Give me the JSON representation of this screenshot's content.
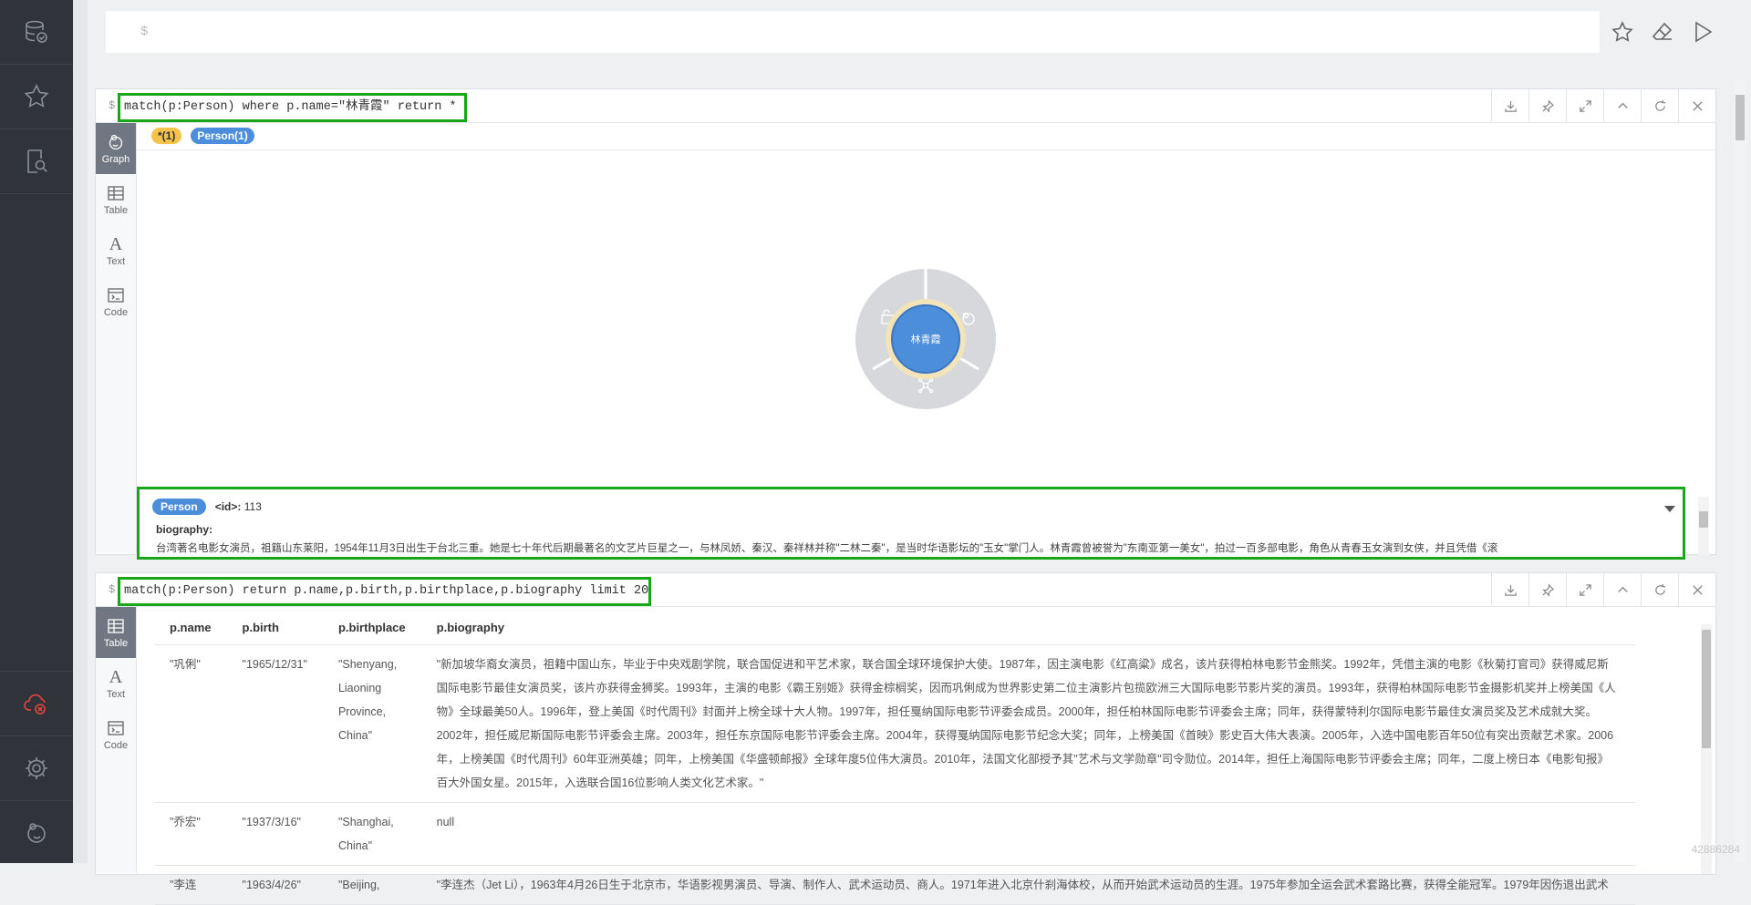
{
  "sidebar": {
    "top_icons": [
      "database-icon",
      "star-icon",
      "search-document-icon"
    ],
    "bottom_icons": [
      "cloud-error-icon",
      "gear-icon",
      "neo4j-logo-icon"
    ]
  },
  "editor": {
    "prompt": "$",
    "actions": [
      "favorite-star-icon",
      "eraser-icon",
      "play-icon"
    ]
  },
  "frame1": {
    "prompt": "$",
    "query": "match(p:Person) where p.name=\"林青霞\" return *",
    "tabs": [
      {
        "label": "Graph",
        "active": true
      },
      {
        "label": "Table",
        "active": false
      },
      {
        "label": "Text",
        "active": false
      },
      {
        "label": "Code",
        "active": false
      }
    ],
    "legend": {
      "any": "*(1)",
      "person": "Person(1)"
    },
    "node": {
      "label": "林青霞",
      "color": "#4c8eda",
      "ring_color": "#f3e3b9"
    },
    "properties": {
      "label": "Person",
      "id_key": "<id>:",
      "id_value": "113",
      "bio_key": "biography:",
      "bio_value": "台湾著名电影女演员，祖籍山东莱阳，1954年11月3日出生于台北三重。她是七十年代后期最著名的文艺片巨星之一，与林凤娇、秦汉、秦祥林并称\"二林二秦\"，是当时华语影坛的\"玉女\"掌门人。林青霞曾被誉为\"东南亚第一美女\"，拍过一百多部电影，角色从青春玉女演到女侠，并且凭借《滚"
    }
  },
  "frame2": {
    "prompt": "$",
    "query": "match(p:Person)  return p.name,p.birth,p.birthplace,p.biography limit 20",
    "tabs": [
      {
        "label": "Table",
        "active": true
      },
      {
        "label": "Text",
        "active": false
      },
      {
        "label": "Code",
        "active": false
      }
    ],
    "columns": [
      "p.name",
      "p.birth",
      "p.birthplace",
      "p.biography"
    ],
    "rows": [
      {
        "name": "\"巩俐\"",
        "birth": "\"1965/12/31\"",
        "birthplace": "\"Shenyang, Liaoning Province, China\"",
        "biography": "\"新加坡华裔女演员，祖籍中国山东，毕业于中央戏剧学院，联合国促进和平艺术家，联合国全球环境保护大使。1987年，因主演电影《红高粱》成名，该片获得柏林电影节金熊奖。1992年，凭借主演的电影《秋菊打官司》获得威尼斯国际电影节最佳女演员奖，该片亦获得金狮奖。1993年，主演的电影《霸王别姬》获得金棕榈奖，因而巩俐成为世界影史第二位主演影片包揽欧洲三大国际电影节影片奖的演员。1993年，获得柏林国际电影节金摄影机奖并上榜美国《人物》全球最美50人。1996年，登上美国《时代周刊》封面并上榜全球十大人物。1997年，担任戛纳国际电影节评委会成员。2000年，担任柏林国际电影节评委会主席；同年，获得蒙特利尔国际电影节最佳女演员奖及艺术成就大奖。2002年，担任威尼斯国际电影节评委会主席。2003年，担任东京国际电影节评委会主席。2004年，获得戛纳国际电影节纪念大奖；同年，上榜美国《首映》影史百大伟大表演。2005年，入选中国电影百年50位有突出贡献艺术家。2006年，上榜美国《时代周刊》60年亚洲英雄；同年，上榜美国《华盛顿邮报》全球年度5位伟大演员。2010年，法国文化部授予其\"艺术与文学勋章\"司令勋位。2014年，担任上海国际电影节评委会主席；同年，二度上榜日本《电影旬报》百大外国女星。2015年，入选联合国16位影响人类文化艺术家。\""
      },
      {
        "name": "\"乔宏\"",
        "birth": "\"1937/3/16\"",
        "birthplace": "\"Shanghai, China\"",
        "biography": "null"
      },
      {
        "name": "\"李连",
        "birth": "\"1963/4/26\"",
        "birthplace": "\"Beijing,",
        "biography": "\"李连杰（Jet Li），1963年4月26日生于北京市，华语影视男演员、导演、制作人、武术运动员、商人。1971年进入北京什刹海体校，从而开始武术运动员的生涯。1975年参加全运会武术套路比赛，获得全能冠军。1979年因伤退出武术"
      }
    ]
  },
  "watermark": "42886284"
}
